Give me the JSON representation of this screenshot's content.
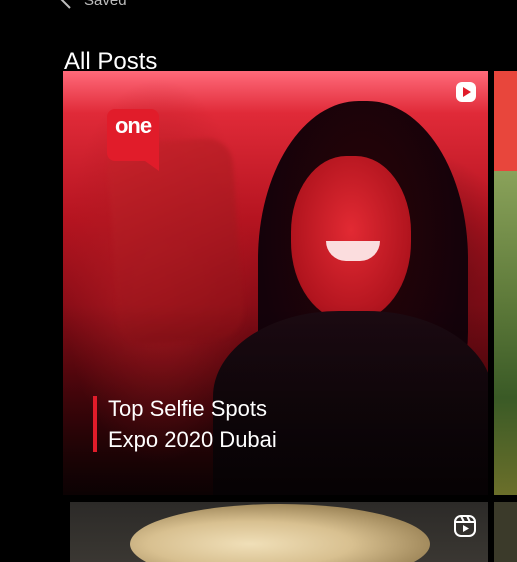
{
  "nav": {
    "back_label": "Saved"
  },
  "page": {
    "title": "All Posts"
  },
  "posts": [
    {
      "brand": "one",
      "caption_line1": "Top Selfie Spots",
      "caption_line2": "Expo 2020 Dubai",
      "type_icon": "play-icon",
      "accent_color": "#e11c2a"
    },
    {
      "type_icon": "reel-icon"
    }
  ]
}
